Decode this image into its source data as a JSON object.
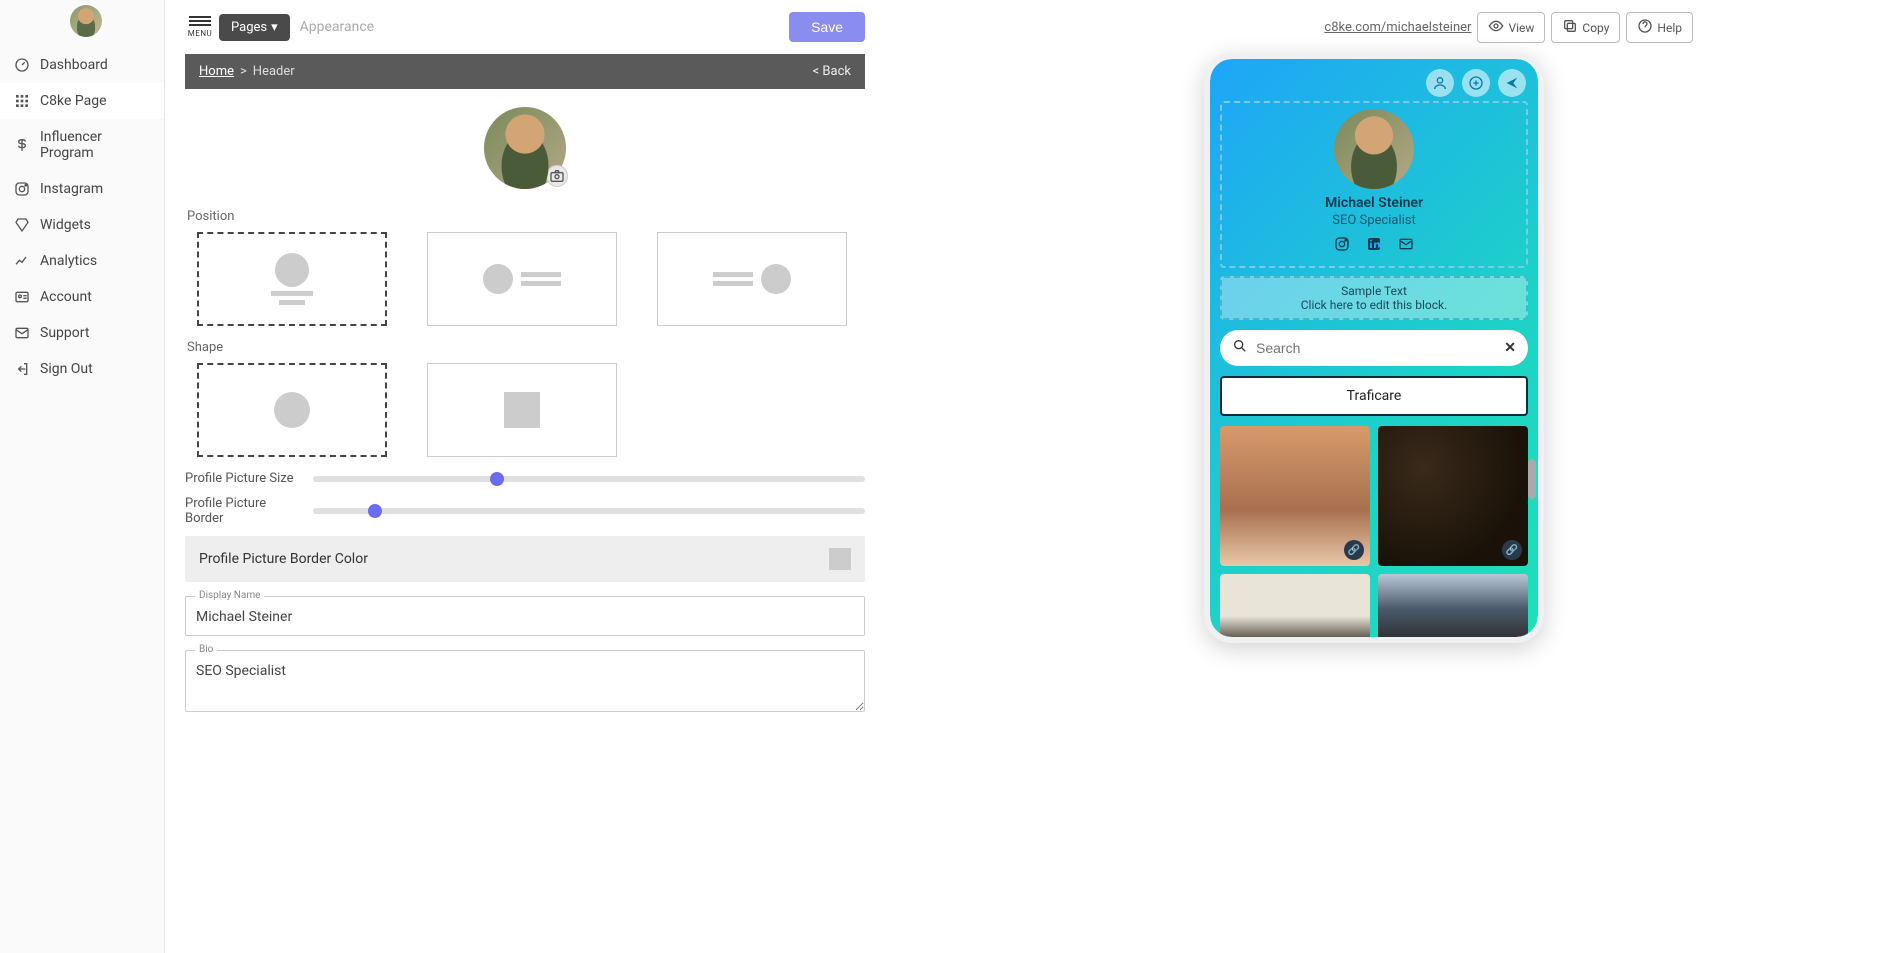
{
  "sidebar": {
    "items": [
      {
        "label": "Dashboard"
      },
      {
        "label": "C8ke Page"
      },
      {
        "label": "Influencer Program"
      },
      {
        "label": "Instagram"
      },
      {
        "label": "Widgets"
      },
      {
        "label": "Analytics"
      },
      {
        "label": "Account"
      },
      {
        "label": "Support"
      },
      {
        "label": "Sign Out"
      }
    ]
  },
  "topbar": {
    "menu_label": "MENU",
    "pages_label": "Pages",
    "appearance_label": "Appearance",
    "save_label": "Save"
  },
  "breadcrumb": {
    "home": "Home",
    "header": "Header",
    "back": "< Back"
  },
  "editor": {
    "position_label": "Position",
    "shape_label": "Shape",
    "size_label": "Profile Picture Size",
    "border_label": "Profile Picture Border",
    "border_color_label": "Profile Picture Border Color",
    "border_color": "#cccccc",
    "size_value_pct": 32,
    "border_value_pct": 10,
    "display_name_label": "Display Name",
    "display_name_value": "Michael Steiner",
    "bio_label": "Bio",
    "bio_value": "SEO Specialist"
  },
  "right": {
    "url": "c8ke.com/michaelsteiner",
    "view": "View",
    "copy": "Copy",
    "help": "Help"
  },
  "preview": {
    "name": "Michael Steiner",
    "bio": "SEO Specialist",
    "sample_title": "Sample Text",
    "sample_sub": "Click here to edit this block.",
    "search_placeholder": "Search",
    "traficare": "Traficare"
  }
}
